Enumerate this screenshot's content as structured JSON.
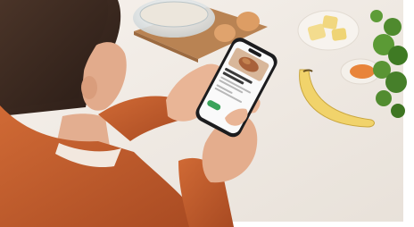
{
  "scene": {
    "description_visible_text": false
  },
  "phone_screen": {
    "title_text": "",
    "button_text": ""
  },
  "colors": {
    "countertop": "#ece6df",
    "background_wall": "#f4efe9",
    "sleeve_orange": "#c8602e",
    "hair_dark": "#3a2a22",
    "skin": "#e9b596",
    "phone_body": "#1c1c1e",
    "screen_white": "#fafafa",
    "screen_green": "#3aa35a",
    "banana_yellow": "#f1d36b",
    "egg_brown": "#e0a36d",
    "board_wood": "#b98353",
    "herb_green": "#4f8a2e"
  }
}
